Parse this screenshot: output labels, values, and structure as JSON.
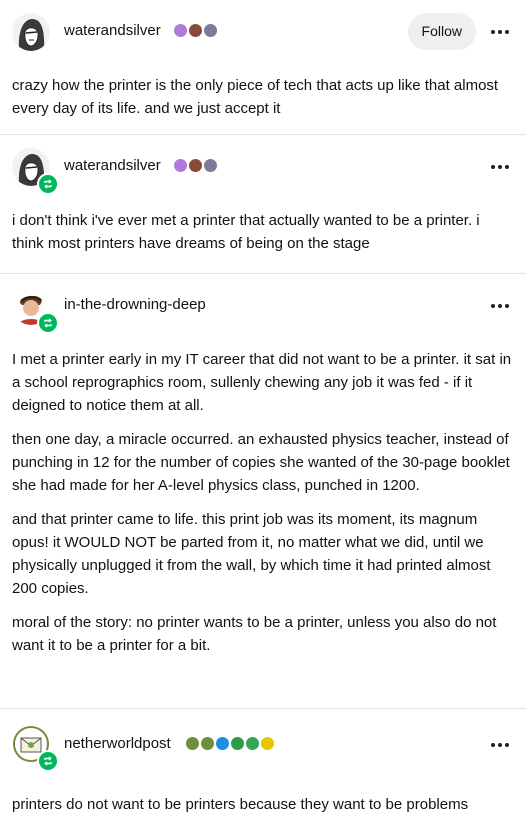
{
  "posts": [
    {
      "username": "waterandsilver",
      "follow_label": "Follow",
      "paragraphs": [
        "crazy how the printer is the only piece of tech that acts up like that almost every day of its life. and we just accept it"
      ],
      "badge_icons": [
        "purple-face-badge",
        "brown-face-badge",
        "gray-face-badge"
      ]
    },
    {
      "username": "waterandsilver",
      "paragraphs": [
        "i don't think i've ever met a printer that actually wanted to be a printer. i think most printers have dreams of being on the stage"
      ],
      "badge_icons": [
        "purple-face-badge",
        "brown-face-badge",
        "gray-face-badge"
      ]
    },
    {
      "username": "in-the-drowning-deep",
      "paragraphs": [
        "I met a printer early in my IT career that did not want to be a printer. it sat in a school reprographics room, sullenly chewing any job it was fed - if it deigned to notice them at all.",
        "then one day, a miracle occurred. an exhausted physics teacher, instead of punching in 12 for the number of copies she wanted of the 30-page booklet she had made for her A-level physics class, punched in 1200.",
        "and that printer came to life. this print job was its moment, its magnum opus! it WOULD NOT be parted from it, no matter what we did, until we physically unplugged it from the wall, by which time it had printed almost 200 copies.",
        "moral of the story: no printer wants to be a printer, unless you also do not want it to be a printer for a bit."
      ]
    },
    {
      "username": "netherworldpost",
      "paragraphs": [
        "printers do not want to be printers because they want to be problems"
      ],
      "badge_icons": [
        "green-frog-badge",
        "green-frog-badge",
        "blue-check-badge",
        "green-check-badge",
        "green-check-badge",
        "yellow-check-badge"
      ]
    }
  ],
  "colors": {
    "reblog_green": "#00b85c",
    "follow_bg": "#efefef",
    "divider": "#e3e3e3"
  }
}
